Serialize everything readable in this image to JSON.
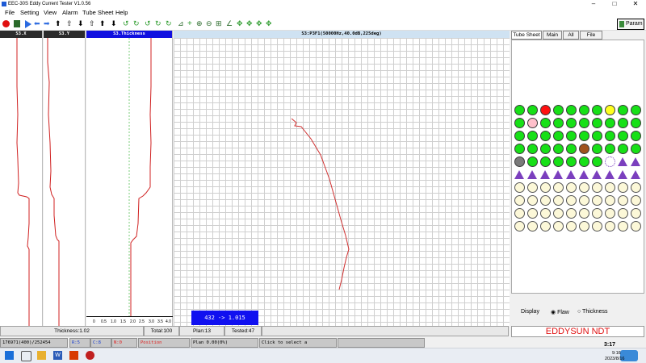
{
  "window": {
    "title": "EEC-30S Eddy Current Tester   V1.0.56"
  },
  "menu": [
    "File",
    "Setting",
    "View",
    "Alarm",
    "Tube Sheet",
    "Help"
  ],
  "toolbar": {
    "param_label": "Param"
  },
  "channels": {
    "x_title": "S3.X",
    "y_title": "S3.Y",
    "thickness_title": "S3.Thickness",
    "lissajous_title": "S3:P3F1(50000Hz,40.0dB,225deg)",
    "thickness_ticks": [
      "0",
      "0.5",
      "1.0",
      "1.5",
      "2.0",
      "2.5",
      "3.0",
      "3.5",
      "4.0"
    ]
  },
  "readout": "432 -> 1.015",
  "status": {
    "thickness": "Thickness:1.02",
    "total": "Total:100",
    "plan": "Plan:13",
    "tested": "Tested:47",
    "field1": "176971(400)/252454",
    "field2": "R:5",
    "field3": "C:8",
    "field4": "N:0",
    "field5": "Position",
    "field6": "Plan 0.00(0%)",
    "field7": "Click to select a comparison"
  },
  "tubesheet": {
    "tabs": [
      "Tube Sheet",
      "Main",
      "All",
      "File"
    ],
    "display_label": "Display",
    "option_flaw": "Flaw",
    "option_thickness": "Thickness",
    "brand": "EDDYSUN NDT",
    "colors": {
      "green": "#17e017",
      "red": "#ff1010",
      "pink": "#ffc0cb",
      "yellow": "#ffff20",
      "brown": "#a0521e",
      "gray": "#7a7a7a",
      "purple": "#7b3fbe",
      "empty": "#fcf8d8"
    }
  },
  "clock": {
    "time": "3:17",
    "time2": "9:16",
    "date": "2023/8/16"
  }
}
